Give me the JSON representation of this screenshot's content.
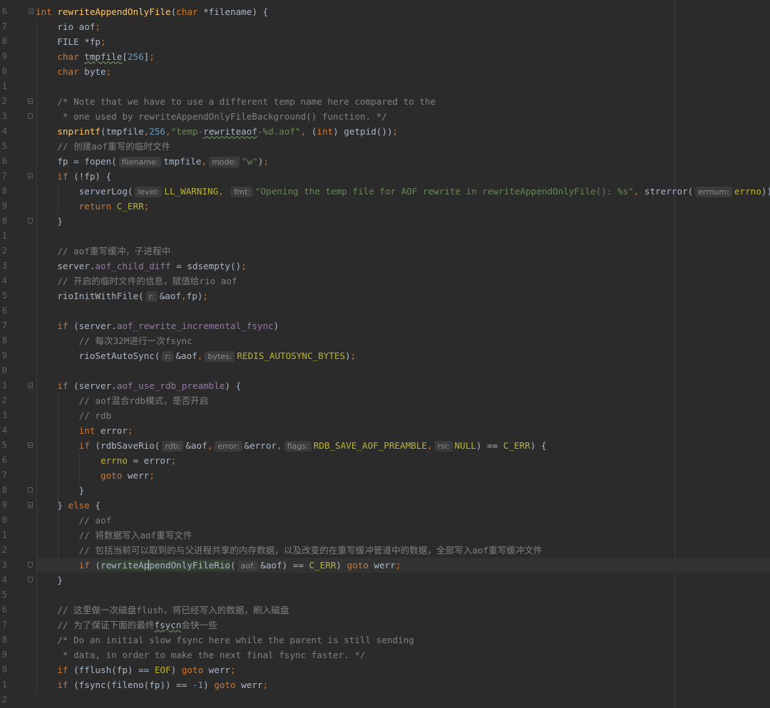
{
  "line_numbers": [
    "6",
    "7",
    "8",
    "9",
    "0",
    "1",
    "2",
    "3",
    "4",
    "5",
    "6",
    "7",
    "8",
    "9",
    "0",
    "1",
    "2",
    "3",
    "4",
    "5",
    "6",
    "7",
    "8",
    "9",
    "0",
    "1",
    "2",
    "3",
    "4",
    "5",
    "6",
    "7",
    "8",
    "9",
    "0",
    "1",
    "2",
    "3",
    "4",
    "5",
    "6",
    "7",
    "8",
    "9",
    "0",
    "1",
    "2"
  ],
  "lines": [
    [
      [
        "kw",
        "int "
      ],
      [
        "fn",
        "rewriteAppendOnlyFile"
      ],
      [
        "id",
        "("
      ],
      [
        "kw",
        "char "
      ],
      [
        "id",
        "*filename) {"
      ]
    ],
    [
      [
        "id",
        "    rio aof"
      ],
      [
        "kw",
        ";"
      ]
    ],
    [
      [
        "id",
        "    FILE *fp"
      ],
      [
        "kw",
        ";"
      ]
    ],
    [
      [
        "kw",
        "    char "
      ],
      [
        "ul",
        "tmpfile"
      ],
      [
        "id",
        "["
      ],
      [
        "num",
        "256"
      ],
      [
        "id",
        "]"
      ],
      [
        "kw",
        ";"
      ]
    ],
    [
      [
        "kw",
        "    char "
      ],
      [
        "id",
        "byte"
      ],
      [
        "kw",
        ";"
      ]
    ],
    [],
    [
      [
        "cm",
        "    /* Note that we have to use a different temp name here compared to the"
      ]
    ],
    [
      [
        "cm",
        "     * one used by rewriteAppendOnlyFileBackground() function. */"
      ]
    ],
    [
      [
        "fn",
        "    snprintf"
      ],
      [
        "id",
        "(tmpfile"
      ],
      [
        "kw",
        ","
      ],
      [
        "num",
        "256"
      ],
      [
        "kw",
        ","
      ],
      [
        "str",
        "\"temp-"
      ],
      [
        "ul",
        "rewriteaof"
      ],
      [
        "str",
        "-%d.aof\""
      ],
      [
        "kw",
        ", "
      ],
      [
        "id",
        "("
      ],
      [
        "kw",
        "int"
      ],
      [
        "id",
        ") getpid())"
      ],
      [
        "kw",
        ";"
      ]
    ],
    [
      [
        "cm",
        "    // 创建aof重写的临时文件"
      ]
    ],
    [
      [
        "id",
        "    fp = fopen("
      ],
      [
        "hint",
        "filename:"
      ],
      [
        "id",
        "tmpfile"
      ],
      [
        "kw",
        ","
      ],
      [
        "hint",
        "mode:"
      ],
      [
        "str",
        "\"w\""
      ],
      [
        "id",
        ")"
      ],
      [
        "kw",
        ";"
      ]
    ],
    [
      [
        "kw",
        "    if "
      ],
      [
        "id",
        "(!fp) {"
      ]
    ],
    [
      [
        "id",
        "        serverLog("
      ],
      [
        "hint",
        "level:"
      ],
      [
        "mac",
        "LL_WARNING"
      ],
      [
        "kw",
        ", "
      ],
      [
        "hint",
        "fmt:"
      ],
      [
        "str",
        "\"Opening the temp file for AOF rewrite in rewriteAppendOnlyFile(): %s\""
      ],
      [
        "kw",
        ", "
      ],
      [
        "id",
        "strerror("
      ],
      [
        "hint",
        "errnum:"
      ],
      [
        "mac",
        "errno"
      ],
      [
        "id",
        "))"
      ],
      [
        "kw",
        ";"
      ]
    ],
    [
      [
        "kw",
        "        return "
      ],
      [
        "mac",
        "C_ERR"
      ],
      [
        "kw",
        ";"
      ]
    ],
    [
      [
        "id",
        "    }"
      ]
    ],
    [],
    [
      [
        "cm",
        "    // aof重写缓冲，子进程中"
      ]
    ],
    [
      [
        "id",
        "    server."
      ],
      [
        "fld",
        "aof_child_diff"
      ],
      [
        "id",
        " = sdsempty()"
      ],
      [
        "kw",
        ";"
      ]
    ],
    [
      [
        "cm",
        "    // 开启的临时文件的信息，赋值给rio aof"
      ]
    ],
    [
      [
        "id",
        "    rioInitWithFile("
      ],
      [
        "hint",
        "r:"
      ],
      [
        "id",
        "&aof"
      ],
      [
        "kw",
        ","
      ],
      [
        "id",
        "fp)"
      ],
      [
        "kw",
        ";"
      ]
    ],
    [],
    [
      [
        "kw",
        "    if "
      ],
      [
        "id",
        "(server."
      ],
      [
        "fld",
        "aof_rewrite_incremental_fsync"
      ],
      [
        "id",
        ")"
      ]
    ],
    [
      [
        "cm",
        "        // 每次32M进行一次fsync"
      ]
    ],
    [
      [
        "id",
        "        rioSetAutoSync("
      ],
      [
        "hint",
        "r:"
      ],
      [
        "id",
        "&aof"
      ],
      [
        "kw",
        ","
      ],
      [
        "hint",
        "bytes:"
      ],
      [
        "mac",
        "REDIS_AUTOSYNC_BYTES"
      ],
      [
        "id",
        ")"
      ],
      [
        "kw",
        ";"
      ]
    ],
    [],
    [
      [
        "kw",
        "    if "
      ],
      [
        "id",
        "(server."
      ],
      [
        "fld",
        "aof_use_rdb_preamble"
      ],
      [
        "id",
        ") {"
      ]
    ],
    [
      [
        "cm",
        "        // aof混合rdb模式，是否开启"
      ]
    ],
    [
      [
        "cm",
        "        // rdb"
      ]
    ],
    [
      [
        "kw",
        "        int "
      ],
      [
        "id",
        "error"
      ],
      [
        "kw",
        ";"
      ]
    ],
    [
      [
        "kw",
        "        if "
      ],
      [
        "id",
        "(rdbSaveRio("
      ],
      [
        "hint",
        "rdb:"
      ],
      [
        "id",
        "&aof"
      ],
      [
        "kw",
        ","
      ],
      [
        "hint",
        "error:"
      ],
      [
        "id",
        "&error"
      ],
      [
        "kw",
        ","
      ],
      [
        "hint",
        "flags:"
      ],
      [
        "mac",
        "RDB_SAVE_AOF_PREAMBLE"
      ],
      [
        "kw",
        ","
      ],
      [
        "hint",
        "rsi:"
      ],
      [
        "mac",
        "NULL"
      ],
      [
        "id",
        ") == "
      ],
      [
        "mac",
        "C_ERR"
      ],
      [
        "id",
        ") {"
      ]
    ],
    [
      [
        "mac",
        "            errno"
      ],
      [
        "id",
        " = error"
      ],
      [
        "kw",
        ";"
      ]
    ],
    [
      [
        "kw",
        "            goto "
      ],
      [
        "id",
        "werr"
      ],
      [
        "kw",
        ";"
      ]
    ],
    [
      [
        "id",
        "        }"
      ]
    ],
    [
      [
        "id",
        "    } "
      ],
      [
        "kw",
        "else "
      ],
      [
        "id",
        "{"
      ]
    ],
    [
      [
        "cm",
        "        // aof"
      ]
    ],
    [
      [
        "cm",
        "        // 将数据写入aof重写文件"
      ]
    ],
    [
      [
        "cm",
        "        // 包括当前可以取到的与父进程共享的内存数据，以及改变的在重写缓冲管道中的数据，全部写入aof重写缓冲文件"
      ]
    ],
    [
      [
        "kw",
        "        if "
      ],
      [
        "id",
        "("
      ],
      [
        "hl",
        "rewriteAp"
      ],
      [
        "caret",
        ""
      ],
      [
        "hl",
        "pendOnlyFileRio"
      ],
      [
        "id",
        "("
      ],
      [
        "hint",
        "aof:"
      ],
      [
        "id",
        "&aof) == "
      ],
      [
        "mac",
        "C_ERR"
      ],
      [
        "id",
        ") "
      ],
      [
        "kw",
        "goto "
      ],
      [
        "id",
        "werr"
      ],
      [
        "kw",
        ";"
      ]
    ],
    [
      [
        "id",
        "    }"
      ]
    ],
    [],
    [
      [
        "cm",
        "    // 这里做一次磁盘flush，将已经写入的数据，刷入磁盘"
      ]
    ],
    [
      [
        "cm",
        "    // 为了保证下面的最终"
      ],
      [
        "ul",
        "fsycn"
      ],
      [
        "cm",
        "会快一些"
      ]
    ],
    [
      [
        "cm",
        "    /* Do an initial slow fsync here while the parent is still sending"
      ]
    ],
    [
      [
        "cm",
        "     * data, in order to make the next final fsync faster. */"
      ]
    ],
    [
      [
        "kw",
        "    if "
      ],
      [
        "id",
        "(fflush(fp) == "
      ],
      [
        "mac",
        "EOF"
      ],
      [
        "id",
        ") "
      ],
      [
        "kw",
        "goto "
      ],
      [
        "id",
        "werr"
      ],
      [
        "kw",
        ";"
      ]
    ],
    [
      [
        "kw",
        "    if "
      ],
      [
        "id",
        "(fsync(fileno(fp)) == "
      ],
      [
        "num",
        "-1"
      ],
      [
        "id",
        ") "
      ],
      [
        "kw",
        "goto "
      ],
      [
        "id",
        "werr"
      ],
      [
        "kw",
        ";"
      ]
    ],
    []
  ]
}
